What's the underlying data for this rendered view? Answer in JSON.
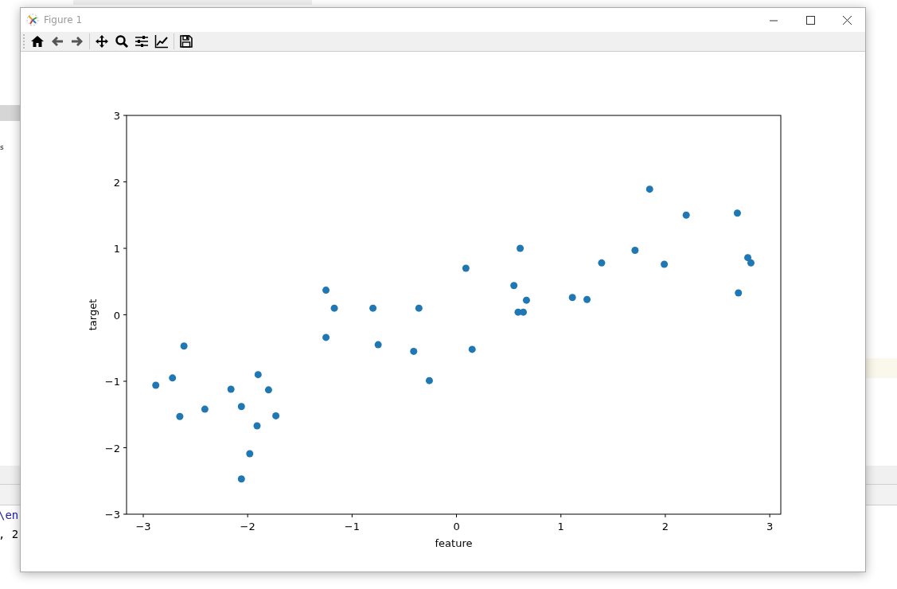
{
  "background": {
    "texts": [
      {
        "text": "s",
        "kind": "plain"
      },
      {
        "text": "\\en",
        "kind": "code-blue"
      },
      {
        "text": ", 2",
        "kind": "code"
      }
    ]
  },
  "window": {
    "title": "Figure 1"
  },
  "toolbar": {
    "buttons": [
      {
        "kind": "home"
      },
      {
        "kind": "back"
      },
      {
        "kind": "forward"
      },
      {
        "kind": "sep"
      },
      {
        "kind": "pan"
      },
      {
        "kind": "zoom"
      },
      {
        "kind": "configure"
      },
      {
        "kind": "edit"
      },
      {
        "kind": "sep"
      },
      {
        "kind": "save"
      }
    ]
  },
  "figure": {
    "chart_data": {
      "type": "scatter",
      "xlabel": "feature",
      "ylabel": "target",
      "x": [
        -2.88,
        -2.72,
        -2.65,
        -2.61,
        -2.41,
        -2.16,
        -2.06,
        -2.06,
        -1.98,
        -1.91,
        -1.9,
        -1.8,
        -1.73,
        -1.25,
        -1.25,
        -1.17,
        -0.8,
        -0.75,
        -0.41,
        -0.36,
        -0.26,
        0.09,
        0.15,
        0.55,
        0.59,
        0.61,
        0.64,
        0.67,
        1.11,
        1.25,
        1.39,
        1.71,
        1.85,
        1.99,
        2.2,
        2.69,
        2.7,
        2.79,
        2.82
      ],
      "series": [
        {
          "color": "#1f77b4",
          "values": [
            -1.06,
            -0.95,
            -1.53,
            -0.47,
            -1.42,
            -1.12,
            -1.38,
            -2.47,
            -2.09,
            -1.67,
            -0.9,
            -1.13,
            -1.52,
            -0.34,
            0.37,
            0.1,
            0.1,
            -0.45,
            -0.55,
            0.1,
            -0.99,
            0.7,
            -0.52,
            0.44,
            0.04,
            1.0,
            0.04,
            0.22,
            0.26,
            0.23,
            0.78,
            0.97,
            1.89,
            0.76,
            1.5,
            1.53,
            0.33,
            0.86,
            0.78
          ]
        }
      ],
      "xlim": [
        -3.16,
        3.106
      ],
      "ylim": [
        -3,
        3
      ],
      "xticks": [
        {
          "value": -3,
          "label": "−3"
        },
        {
          "value": -2,
          "label": "−2"
        },
        {
          "value": -1,
          "label": "−1"
        },
        {
          "value": 0,
          "label": "0"
        },
        {
          "value": 1,
          "label": "1"
        },
        {
          "value": 2,
          "label": "2"
        },
        {
          "value": 3,
          "label": "3"
        }
      ],
      "yticks": [
        {
          "value": -3,
          "label": "−3"
        },
        {
          "value": -2,
          "label": "−2"
        },
        {
          "value": -1,
          "label": "−1"
        },
        {
          "value": 0,
          "label": "0"
        },
        {
          "value": 1,
          "label": "1"
        },
        {
          "value": 2,
          "label": "2"
        },
        {
          "value": 3,
          "label": "3"
        }
      ]
    }
  }
}
